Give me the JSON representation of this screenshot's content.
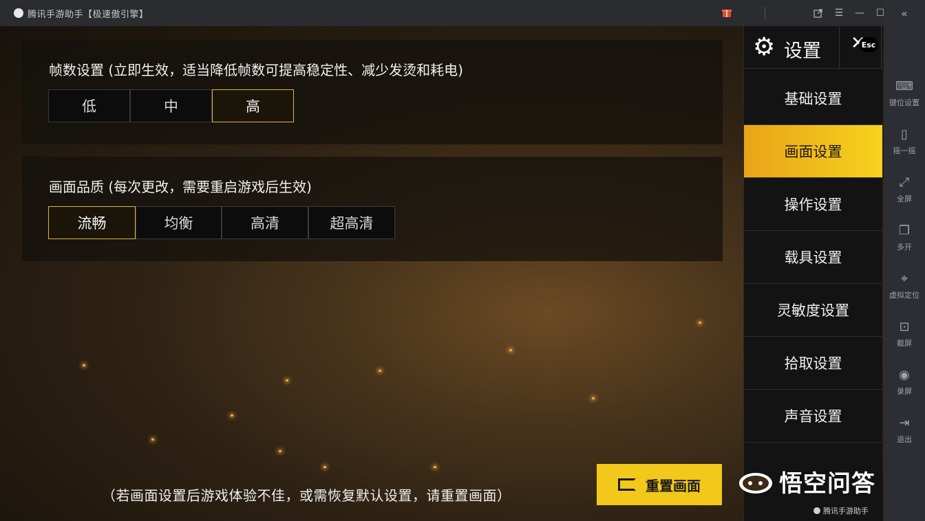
{
  "window": {
    "title": "腾讯手游助手【极速傲引擎】"
  },
  "frame_panel": {
    "heading": "帧数设置 (立即生效，适当降低帧数可提高稳定性、减少发烫和耗电)",
    "options": [
      "低",
      "中",
      "高"
    ],
    "selected": "高"
  },
  "quality_panel": {
    "heading": "画面品质 (每次更改，需要重启游戏后生效)",
    "options": [
      "流畅",
      "均衡",
      "高清",
      "超高清"
    ],
    "selected": "流畅"
  },
  "footer": {
    "note": "（若画面设置后游戏体验不佳，或需恢复默认设置，请重置画面）",
    "reset_label": "重置画面"
  },
  "settings_menu": {
    "title": "设置",
    "esc_label": "Esc",
    "items": [
      "基础设置",
      "画面设置",
      "操作设置",
      "载具设置",
      "灵敏度设置",
      "拾取设置",
      "声音设置"
    ],
    "active": "画面设置"
  },
  "right_toolbar": {
    "items": [
      "键位设置",
      "摇一摇",
      "全屏",
      "多开",
      "虚拟定位",
      "截屏",
      "录屏",
      "退出"
    ]
  },
  "watermark": {
    "brand": "悟空问答",
    "sub": "腾讯手游助手"
  },
  "colors": {
    "accent": "#f2c81a",
    "menu_active": "#f6d21f",
    "selected_border": "#e1b53a"
  }
}
